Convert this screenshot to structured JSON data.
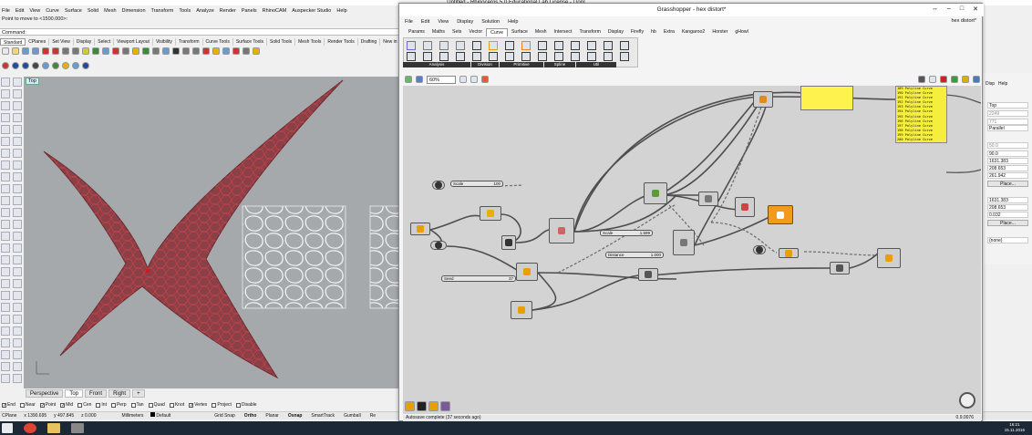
{
  "rhino": {
    "title": "Untitled - Rhinoceros 5.0 Educational Lab License - [Top]",
    "menu": [
      "File",
      "Edit",
      "View",
      "Curve",
      "Surface",
      "Solid",
      "Mesh",
      "Dimension",
      "Transform",
      "Tools",
      "Analyze",
      "Render",
      "Panels",
      "RhinoCAM",
      "Auspecker Studio",
      "Help"
    ],
    "command_history": "Point to move to <1500.000>:",
    "command_label": "Command:",
    "toolbar_tabs": [
      "Standard",
      "CPlanes",
      "Set View",
      "Display",
      "Select",
      "Viewport Layout",
      "Visibility",
      "Transform",
      "Curve Tools",
      "Surface Tools",
      "Solid Tools",
      "Mesh Tools",
      "Render Tools",
      "Drafting",
      "New in"
    ],
    "viewport_label": "Top",
    "viewport_tabs": [
      "Perspective",
      "Top",
      "Front",
      "Right",
      "+"
    ],
    "active_viewport_tab": "Top",
    "osnaps": [
      {
        "label": "End",
        "checked": true
      },
      {
        "label": "Near",
        "checked": false
      },
      {
        "label": "Point",
        "checked": true
      },
      {
        "label": "Mid",
        "checked": true
      },
      {
        "label": "Cen",
        "checked": false
      },
      {
        "label": "Int",
        "checked": false
      },
      {
        "label": "Perp",
        "checked": false
      },
      {
        "label": "Tan",
        "checked": false
      },
      {
        "label": "Quad",
        "checked": false
      },
      {
        "label": "Knot",
        "checked": false
      },
      {
        "label": "Vertex",
        "checked": true
      },
      {
        "label": "Project",
        "checked": false
      },
      {
        "label": "Disable",
        "checked": false
      }
    ],
    "status": {
      "cplane": "CPlane",
      "x": "x 1390.695",
      "y": "y 497.845",
      "z": "z 0.000",
      "units": "Millimeters",
      "layer": "Default",
      "toggles": [
        "Grid Snap",
        "Ortho",
        "Planar",
        "Osnap",
        "SmartTrack",
        "Gumball",
        "Re"
      ]
    },
    "props": {
      "tabs": [
        "Disp",
        "Help"
      ],
      "view_name": "Top",
      "v1": "2249",
      "v2": "771",
      "projection": "Parallel",
      "lens": "50.0",
      "lens2": "90.0",
      "cam_x": "1631.383",
      "cam_y": "208.653",
      "cam_z": "261.942",
      "place1": "Place...",
      "tgt_x": "1631.383",
      "tgt_y": "208.653",
      "tgt_z": "0.032",
      "place2": "Place...",
      "wallpaper": "(none)"
    }
  },
  "grasshopper": {
    "title": "Grasshopper - hex distort*",
    "doc_name": "hex distort*",
    "menu": [
      "File",
      "Edit",
      "View",
      "Display",
      "Solution",
      "Help"
    ],
    "tabs": [
      "Params",
      "Maths",
      "Sets",
      "Vector",
      "Curve",
      "Surface",
      "Mesh",
      "Intersect",
      "Transform",
      "Display",
      "Firefly",
      "hb",
      "Extra",
      "Kangaroo2",
      "Horster",
      "gHowl"
    ],
    "active_tab": "Curve",
    "groups": [
      "Analysis",
      "Division",
      "Primitive",
      "Spline",
      "Util"
    ],
    "zoom": "60%",
    "status": "Autosave complete (37 seconds ago)",
    "version": "0.9.0076",
    "sliders": [
      {
        "label": "Scale",
        "value": "100"
      },
      {
        "label": "Scale",
        "value": "1.599"
      },
      {
        "label": "Distance",
        "value": "1.000"
      },
      {
        "label": "Seed",
        "value": "37"
      }
    ],
    "list_lines": [
      "189 Polyline Curve",
      "190 Polyline Curve",
      "191 Polyline Curve",
      "192 Polyline Curve",
      "193 Polyline Curve",
      "194 Polyline Curve",
      "195 Polyline Curve",
      "196 Polyline Curve",
      "197 Polyline Curve",
      "198 Polyline Curve",
      "199 Polyline Curve",
      "200 Polyline Curve"
    ]
  },
  "taskbar": {
    "time": "16:21",
    "date": "15.11.2016"
  },
  "colors": {
    "viewport_bg": "#a6a9ac",
    "surface": "#8a4046",
    "mesh_lines": "#d8434a",
    "canvas_bg": "#d3d3d3",
    "panel_yellow": "#f6ee3c",
    "selected_component": "#f29a1c"
  }
}
